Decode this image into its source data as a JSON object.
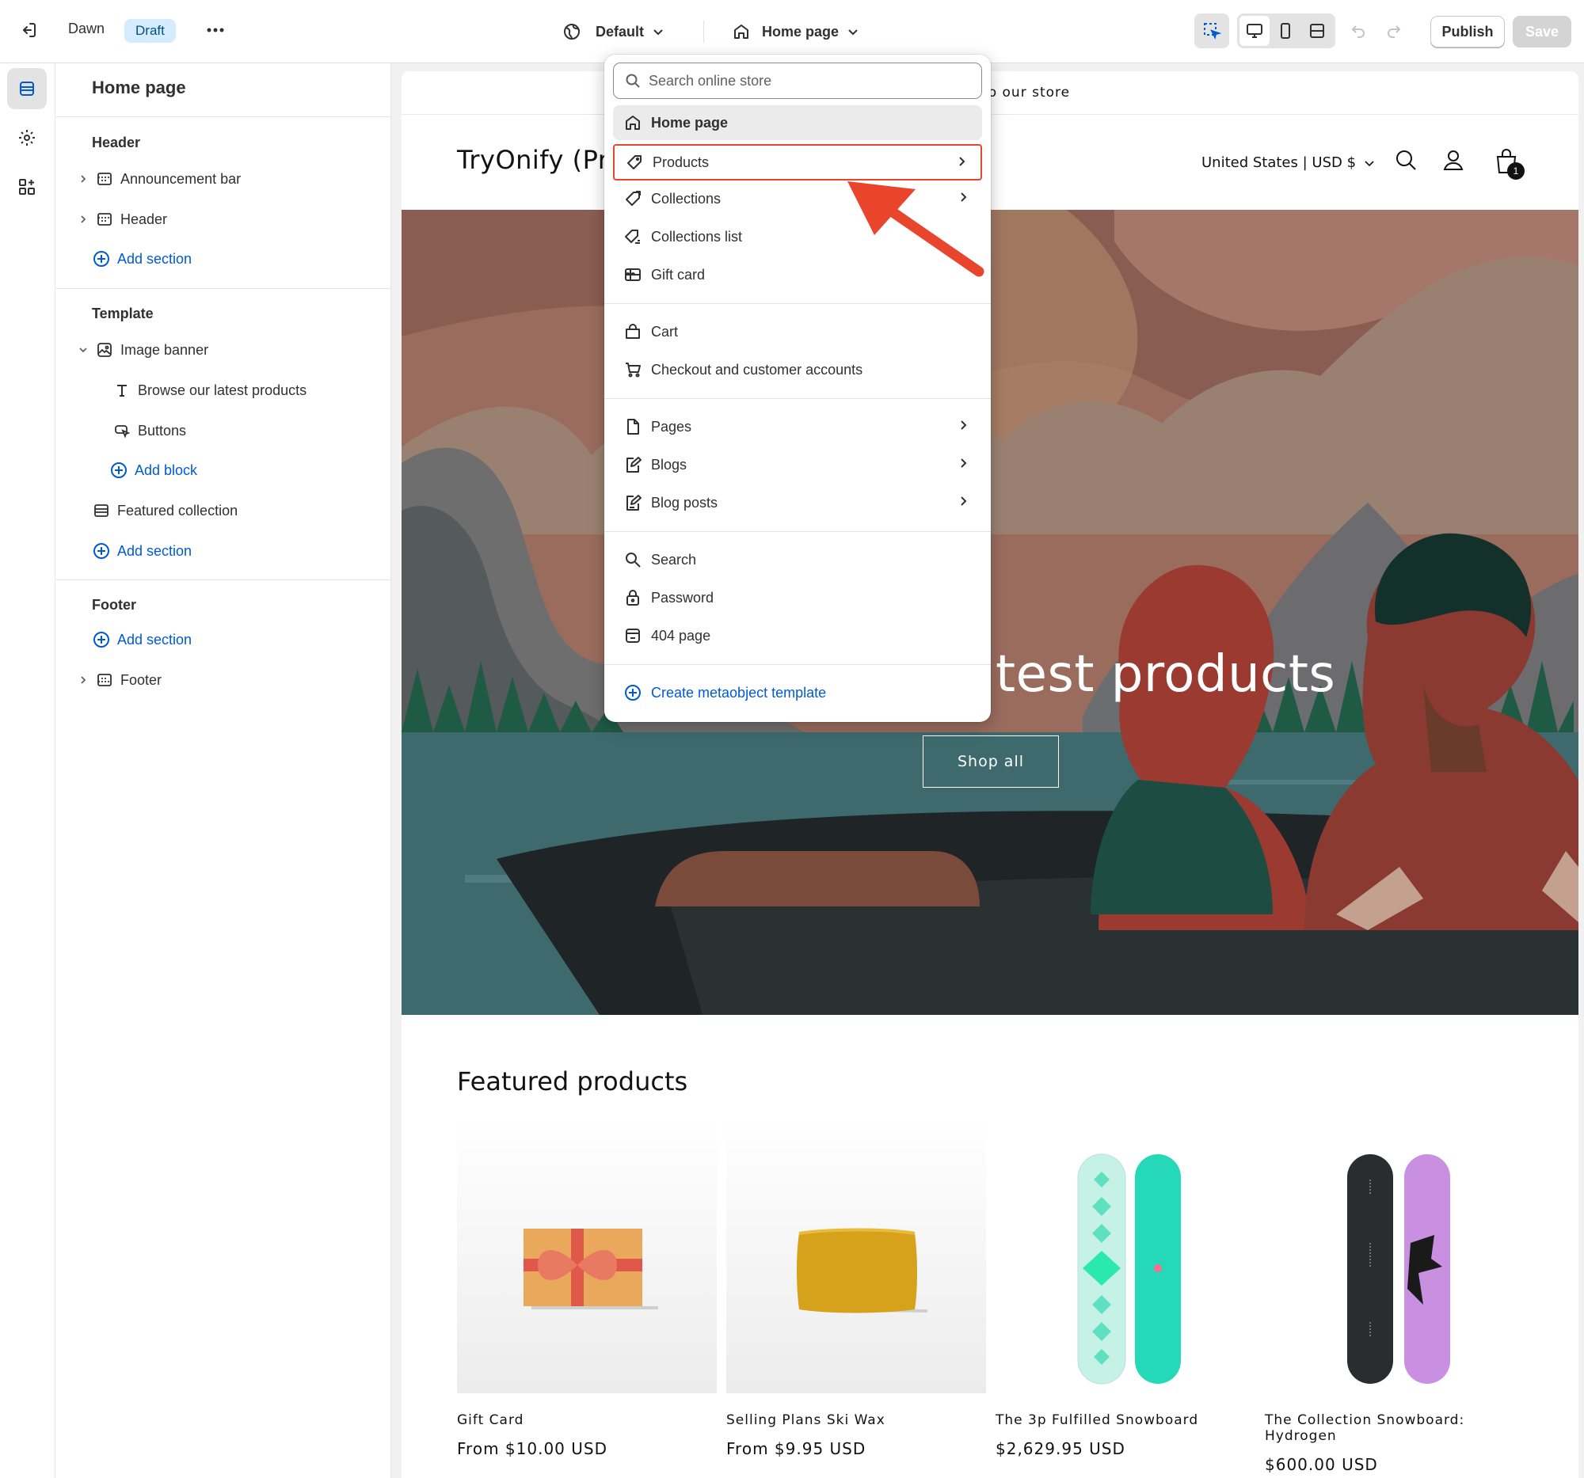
{
  "topbar": {
    "theme_name": "Dawn",
    "draft_badge": "Draft",
    "context_selector": "Default",
    "page_selector": "Home page",
    "publish_label": "Publish",
    "save_label": "Save"
  },
  "sidebar": {
    "title": "Home page",
    "header_group": "Header",
    "header_items": [
      "Announcement bar",
      "Header"
    ],
    "add_section": "Add section",
    "template_group": "Template",
    "image_banner": "Image banner",
    "banner_blocks": [
      "Browse our latest products",
      "Buttons"
    ],
    "add_block": "Add block",
    "featured_collection": "Featured collection",
    "footer_group": "Footer",
    "footer_item": "Footer"
  },
  "dropdown": {
    "search_placeholder": "Search online store",
    "items": [
      {
        "label": "Home page",
        "icon": "home-icon",
        "selected": true
      },
      {
        "label": "Products",
        "icon": "tag-icon",
        "submenu": true,
        "highlighted": true
      },
      {
        "label": "Collections",
        "icon": "collection-icon",
        "submenu": true
      },
      {
        "label": "Collections list",
        "icon": "collection-list-icon"
      },
      {
        "label": "Gift card",
        "icon": "gift-card-icon"
      },
      {
        "label": "Cart",
        "icon": "bag-icon"
      },
      {
        "label": "Checkout and customer accounts",
        "icon": "cart-icon"
      },
      {
        "label": "Pages",
        "icon": "page-icon",
        "submenu": true
      },
      {
        "label": "Blogs",
        "icon": "blog-icon",
        "submenu": true
      },
      {
        "label": "Blog posts",
        "icon": "blog-post-icon",
        "submenu": true
      },
      {
        "label": "Search",
        "icon": "search-icon"
      },
      {
        "label": "Password",
        "icon": "lock-icon"
      },
      {
        "label": "404 page",
        "icon": "404-icon"
      }
    ],
    "create_metaobject": "Create metaobject template"
  },
  "store": {
    "announcement": "Welcome to our store",
    "logo": "TryOnify (Pro)",
    "locale": "United States | USD $",
    "cart_count": "1",
    "hero_heading": "Browse our latest products",
    "hero_button": "Shop all",
    "featured_title": "Featured products",
    "products": [
      {
        "name": "Gift Card",
        "price": "From $10.00 USD"
      },
      {
        "name": "Selling Plans Ski Wax",
        "price": "From $9.95 USD"
      },
      {
        "name": "The 3p Fulfilled Snowboard",
        "price": "$2,629.95 USD"
      },
      {
        "name": "The Collection Snowboard: Hydrogen",
        "price": "$600.00 USD"
      }
    ]
  },
  "colors": {
    "accent_blue": "#005bd3",
    "highlight_red": "#e8452c",
    "draft_badge_bg": "#d5ebff"
  }
}
